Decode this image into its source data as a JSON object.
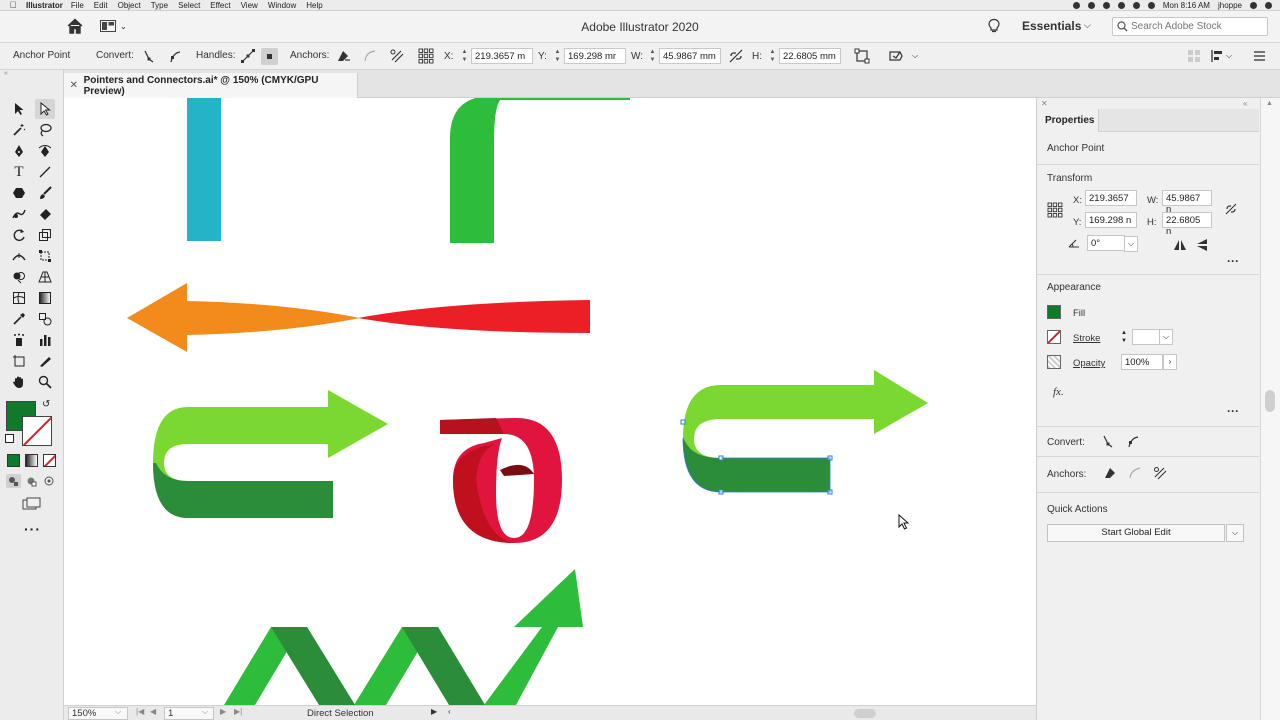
{
  "menubar": {
    "app": "Illustrator",
    "items": [
      "File",
      "Edit",
      "Object",
      "Type",
      "Select",
      "Effect",
      "View",
      "Window",
      "Help"
    ],
    "clock": "Mon 8:16 AM",
    "user": "jhoppe"
  },
  "appbar": {
    "title": "Adobe Illustrator 2020",
    "workspace": "Essentials",
    "search_placeholder": "Search Adobe Stock"
  },
  "controlbar": {
    "selection_type": "Anchor Point",
    "convert_label": "Convert:",
    "handles_label": "Handles:",
    "anchors_label": "Anchors:",
    "x_label": "X:",
    "x_value": "219.3657 m",
    "y_label": "Y:",
    "y_value": "169.298 mr",
    "w_label": "W:",
    "w_value": "45.9867 mm",
    "h_label": "H:",
    "h_value": "22.6805 mm"
  },
  "document_tab": {
    "name": "Pointers and Connectors.ai* @ 150% (CMYK/GPU Preview)"
  },
  "statusbar": {
    "zoom": "150%",
    "page": "1",
    "tool": "Direct Selection"
  },
  "properties": {
    "tab": "Properties",
    "selection": "Anchor Point",
    "transform_title": "Transform",
    "x_label": "X:",
    "x_value": "219.3657",
    "y_label": "Y:",
    "y_value": "169.298 n",
    "w_label": "W:",
    "w_value": "45.9867 n",
    "h_label": "H:",
    "h_value": "22.6805 n",
    "rotate_value": "0°",
    "appearance_title": "Appearance",
    "fill_label": "Fill",
    "stroke_label": "Stroke",
    "opacity_label": "Opacity",
    "opacity_value": "100%",
    "fx_label": "fx.",
    "convert_label": "Convert:",
    "anchors_label": "Anchors:",
    "quick_actions_title": "Quick Actions",
    "start_global_edit": "Start Global Edit"
  },
  "colors": {
    "fill": "#0e7a2a",
    "stroke_none": "#d6222a",
    "teal": "#23b4c8",
    "green": "#2ebd3a",
    "lime": "#7ad830",
    "dark_green": "#2b8c3a",
    "orange": "#f28a1c",
    "red": "#ec1f27",
    "crimson": "#e0143c"
  },
  "icons": {
    "home": "home-icon",
    "search": "search-icon",
    "bulb": "lightbulb-icon"
  }
}
